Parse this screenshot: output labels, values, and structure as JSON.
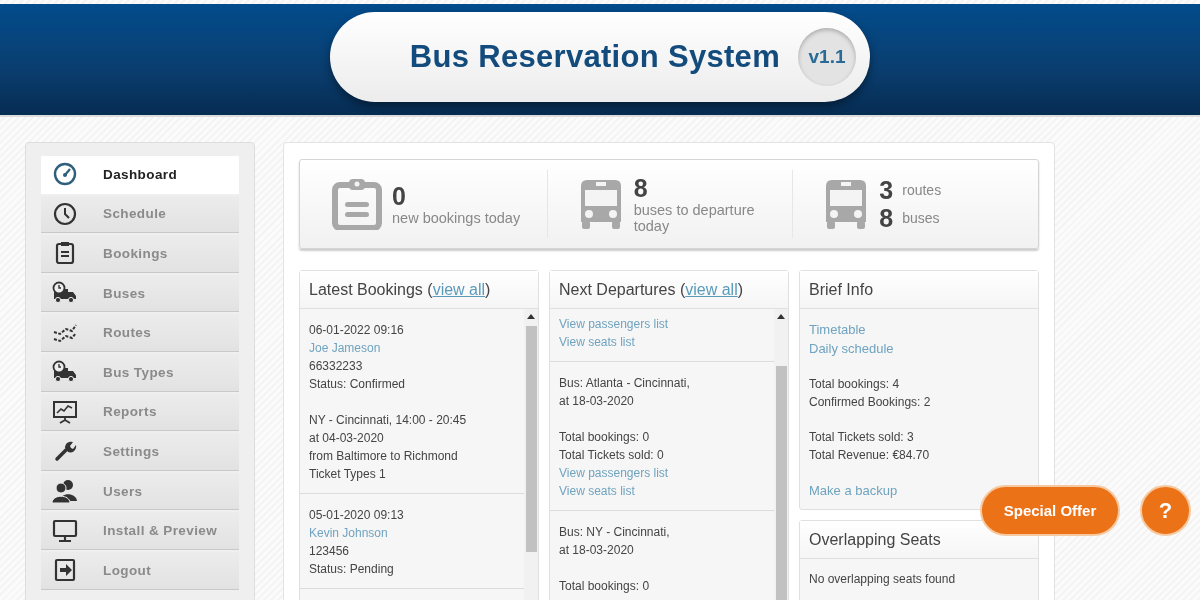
{
  "header": {
    "title": "Bus Reservation System",
    "version": "v1.1"
  },
  "sidebar": {
    "items": [
      {
        "label": "Dashboard",
        "selected": true
      },
      {
        "label": "Schedule",
        "selected": false
      },
      {
        "label": "Bookings",
        "selected": false
      },
      {
        "label": "Buses",
        "selected": false
      },
      {
        "label": "Routes",
        "selected": false
      },
      {
        "label": "Bus Types",
        "selected": false
      },
      {
        "label": "Reports",
        "selected": false
      },
      {
        "label": "Settings",
        "selected": false
      },
      {
        "label": "Users",
        "selected": false
      },
      {
        "label": "Install & Preview",
        "selected": false
      },
      {
        "label": "Logout",
        "selected": false
      }
    ]
  },
  "stats": [
    {
      "kind": "single",
      "rows": [
        {
          "value": "0",
          "label": "new bookings today"
        }
      ]
    },
    {
      "kind": "single",
      "rows": [
        {
          "value": "8",
          "label": "buses to departure today"
        }
      ]
    },
    {
      "kind": "double",
      "rows": [
        {
          "value": "3",
          "label": "routes"
        },
        {
          "value": "8",
          "label": "buses"
        }
      ]
    }
  ],
  "panels": [
    {
      "title": "Latest Bookings (",
      "link": "view all",
      "title_end": ")",
      "entries": [
        {
          "groups": [
            [
              {
                "kind": "text",
                "text": "06-01-2022 09:16"
              },
              {
                "kind": "link",
                "text": "Joe Jameson"
              },
              {
                "kind": "text",
                "text": "66332233"
              },
              {
                "kind": "text",
                "text": "Status: Confirmed"
              }
            ],
            [
              {
                "kind": "text",
                "text": "NY - Cincinnati, 14:00 - 20:45"
              },
              {
                "kind": "text",
                "text": "at 04-03-2020"
              },
              {
                "kind": "text",
                "text": "from Baltimore to Richmond"
              },
              {
                "kind": "text",
                "text": "Ticket Types 1"
              }
            ]
          ]
        },
        {
          "groups": [
            [
              {
                "kind": "text",
                "text": "05-01-2020 09:13"
              },
              {
                "kind": "link",
                "text": "Kevin Johnson"
              },
              {
                "kind": "text",
                "text": "123456"
              },
              {
                "kind": "text",
                "text": "Status: Pending"
              }
            ]
          ]
        }
      ]
    },
    {
      "title": "Next Departures (",
      "link": "view all",
      "title_end": ")",
      "entries": [
        {
          "groups": [
            [
              {
                "kind": "link",
                "text": "View passengers list"
              },
              {
                "kind": "link",
                "text": "View seats list"
              }
            ]
          ]
        },
        {
          "groups": [
            [
              {
                "kind": "text",
                "text": "Bus: Atlanta - Cincinnati,"
              },
              {
                "kind": "text",
                "text": "at 18-03-2020"
              }
            ],
            [
              {
                "kind": "text",
                "text": "Total bookings: 0"
              },
              {
                "kind": "text",
                "text": "Total Tickets sold: 0"
              },
              {
                "kind": "link",
                "text": "View passengers list"
              },
              {
                "kind": "link",
                "text": "View seats list"
              }
            ]
          ]
        },
        {
          "groups": [
            [
              {
                "kind": "text",
                "text": "Bus: NY - Cincinnati,"
              },
              {
                "kind": "text",
                "text": "at 18-03-2020"
              }
            ],
            [
              {
                "kind": "text",
                "text": "Total bookings: 0"
              }
            ]
          ]
        }
      ]
    }
  ],
  "brief_info": {
    "title": "Brief Info",
    "groups": [
      [
        {
          "kind": "biglink",
          "text": "Timetable"
        },
        {
          "kind": "biglink",
          "text": "Daily schedule"
        }
      ],
      [
        {
          "kind": "text",
          "text": "Total bookings: 4"
        },
        {
          "kind": "text",
          "text": "Confirmed Bookings: 2"
        }
      ],
      [
        {
          "kind": "text",
          "text": "Total Tickets sold: 3"
        },
        {
          "kind": "text",
          "text": "Total Revenue: €84.70"
        }
      ],
      [
        {
          "kind": "biglink",
          "text": "Make a backup"
        }
      ]
    ]
  },
  "overlapping": {
    "title": "Overlapping Seats",
    "message": "No overlapping seats found"
  },
  "floating": {
    "offer": "Special Offer",
    "help": "?"
  }
}
